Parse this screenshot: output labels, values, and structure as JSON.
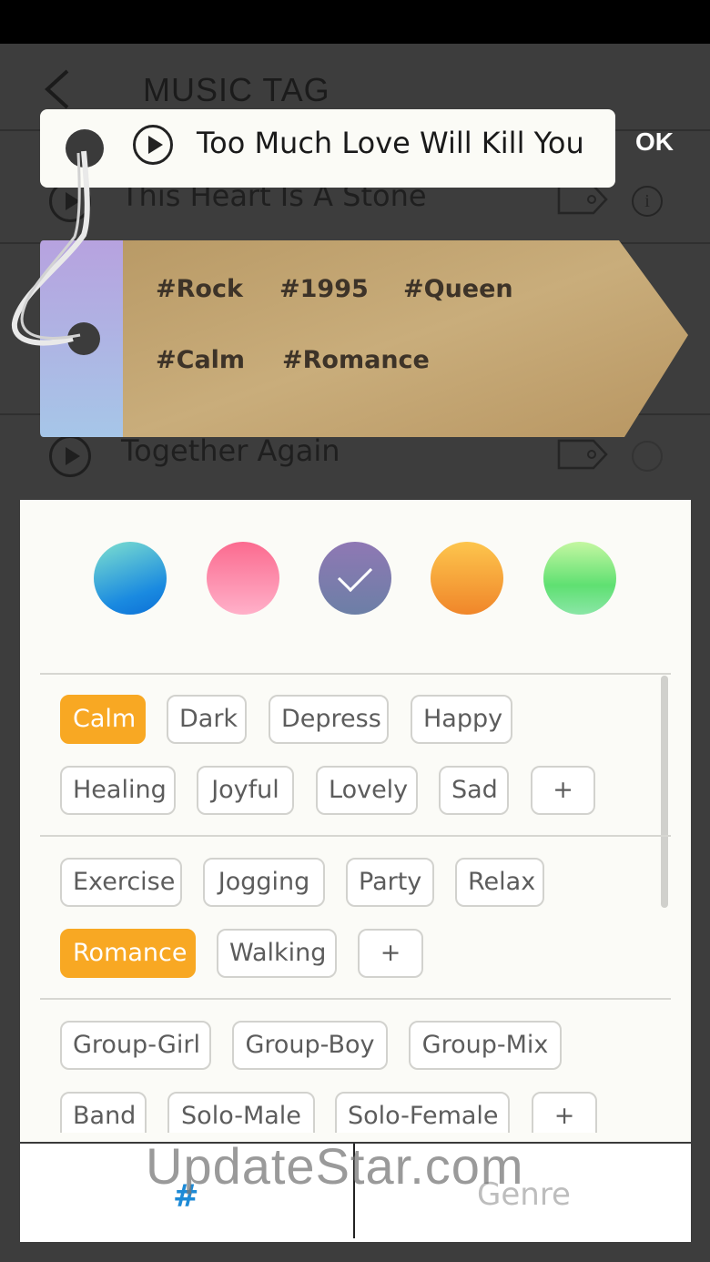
{
  "app": {
    "title": "MUSIC TAG",
    "ok_label": "OK"
  },
  "background_songs": [
    {
      "title": "This Heart Is A Stone"
    },
    {
      "title": "Together Again"
    }
  ],
  "current_song": {
    "title": "Too Much Love Will Kill You"
  },
  "tag": {
    "row1": [
      "#Rock",
      "#1995",
      "#Queen"
    ],
    "row2": [
      "#Calm",
      "#Romance"
    ]
  },
  "colors": {
    "accent_orange": "#f8a823",
    "tab_active_blue": "#1d8ad6"
  },
  "swatches": [
    {
      "name": "blue",
      "selected": false
    },
    {
      "name": "pink",
      "selected": false
    },
    {
      "name": "purple",
      "selected": true
    },
    {
      "name": "orange",
      "selected": false
    },
    {
      "name": "green",
      "selected": false
    }
  ],
  "chip_groups": [
    {
      "chips": [
        {
          "label": "Calm",
          "active": true
        },
        {
          "label": "Dark",
          "active": false
        },
        {
          "label": "Depress",
          "active": false
        },
        {
          "label": "Happy",
          "active": false
        },
        {
          "label": "Healing",
          "active": false
        },
        {
          "label": "Joyful",
          "active": false
        },
        {
          "label": "Lovely",
          "active": false
        },
        {
          "label": "Sad",
          "active": false
        },
        {
          "label": "+",
          "active": false
        }
      ]
    },
    {
      "chips": [
        {
          "label": "Exercise",
          "active": false
        },
        {
          "label": "Jogging",
          "active": false
        },
        {
          "label": "Party",
          "active": false
        },
        {
          "label": "Relax",
          "active": false
        },
        {
          "label": "Romance",
          "active": true
        },
        {
          "label": "Walking",
          "active": false
        },
        {
          "label": "+",
          "active": false
        }
      ]
    },
    {
      "chips": [
        {
          "label": "Group-Girl",
          "active": false
        },
        {
          "label": "Group-Boy",
          "active": false
        },
        {
          "label": "Group-Mix",
          "active": false
        },
        {
          "label": "Band",
          "active": false
        },
        {
          "label": "Solo-Male",
          "active": false
        },
        {
          "label": "Solo-Female",
          "active": false
        },
        {
          "label": "+",
          "active": false
        }
      ]
    }
  ],
  "bottom_tabs": {
    "hash_label": "#",
    "genre_label": "Genre"
  },
  "watermark": "UpdateStar.com"
}
